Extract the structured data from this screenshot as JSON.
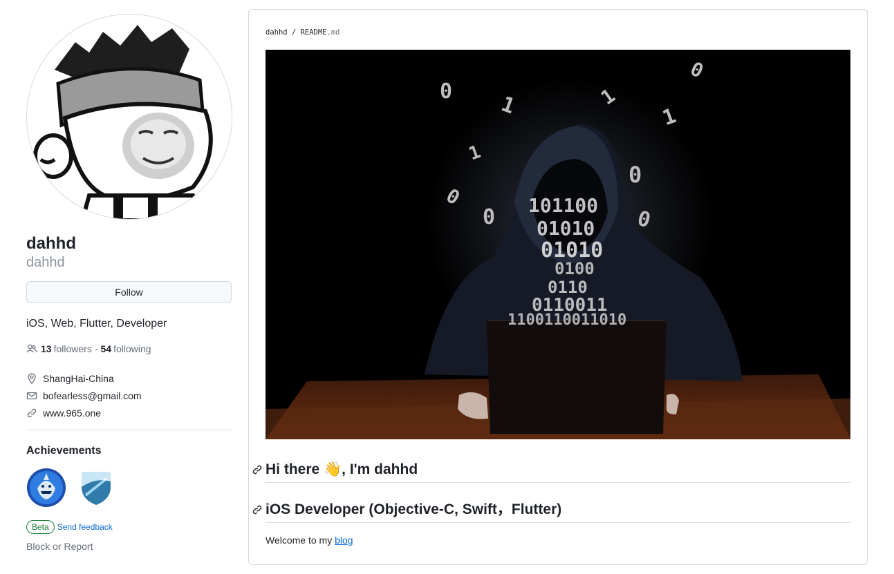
{
  "profile": {
    "name": "dahhd",
    "login": "dahhd",
    "follow_label": "Follow",
    "bio": "iOS, Web, Flutter, Developer",
    "followers_count": "13",
    "followers_label": "followers",
    "separator": "·",
    "following_count": "54",
    "following_label": "following",
    "location": "ShangHai-China",
    "email": "bofearless@gmail.com",
    "website": "www.965.one"
  },
  "achievements": {
    "title": "Achievements",
    "badges": [
      "shark-badge",
      "arctic-badge"
    ],
    "beta_label": "Beta",
    "feedback_label": "Send feedback"
  },
  "block_label": "Block or Report",
  "readme": {
    "breadcrumb_owner": "dahhd",
    "breadcrumb_sep": " / ",
    "breadcrumb_file": "README",
    "breadcrumb_ext": ".md",
    "heading1": "Hi there 👋, I'm dahhd",
    "heading2": "iOS Developer (Objective-C, Swift，Flutter)",
    "welcome_text": "Welcome to my ",
    "blog_link": "blog"
  },
  "colors": {
    "link": "#0969da",
    "beta_green": "#1a7f37",
    "muted": "#656d76",
    "border": "#d0d7de"
  }
}
